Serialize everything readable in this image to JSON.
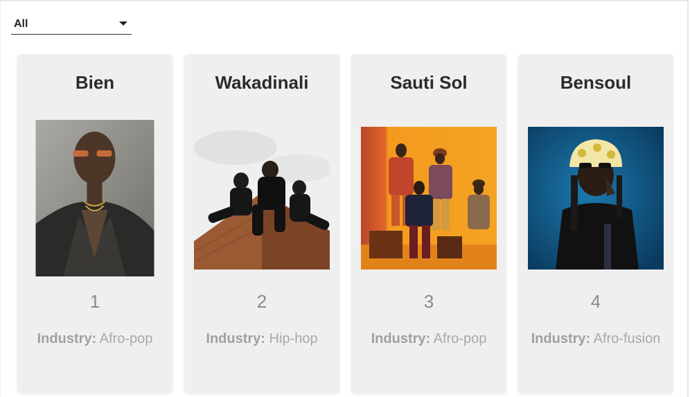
{
  "filter": {
    "selected": "All"
  },
  "artists": [
    {
      "name": "Bien",
      "rank": "1",
      "industry_label": "Industry:",
      "industry": "Afro-pop",
      "photo_icon": "portrait-man-leather-jacket"
    },
    {
      "name": "Wakadinali",
      "rank": "2",
      "industry_label": "Industry:",
      "industry": "Hip-hop",
      "photo_icon": "group-sitting-on-brick-wall"
    },
    {
      "name": "Sauti Sol",
      "rank": "3",
      "industry_label": "Industry:",
      "industry": "Afro-pop",
      "photo_icon": "group-on-orange-backdrop"
    },
    {
      "name": "Bensoul",
      "rank": "4",
      "industry_label": "Industry:",
      "industry": "Afro-fusion",
      "photo_icon": "man-bucket-hat-blue-backdrop"
    }
  ]
}
